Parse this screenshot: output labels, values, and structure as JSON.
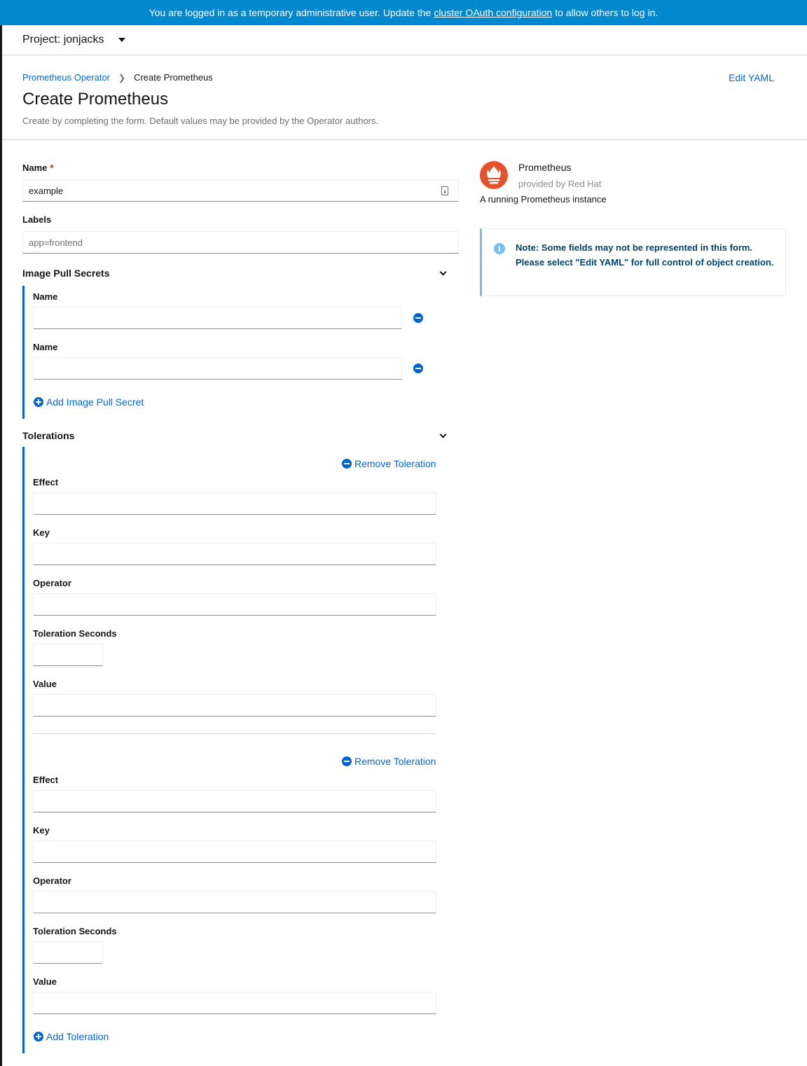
{
  "banner": {
    "text_before": "You are logged in as a temporary administrative user. Update the",
    "link": "cluster OAuth configuration",
    "text_after": "to allow others to log in."
  },
  "project": {
    "label": "Project: jonjacks"
  },
  "breadcrumb": {
    "parent": "Prometheus Operator",
    "current": "Create Prometheus"
  },
  "header": {
    "edit_yaml": "Edit YAML",
    "title": "Create Prometheus",
    "description": "Create by completing the form. Default values may be provided by the Operator authors."
  },
  "form": {
    "name_label": "Name",
    "required_mark": "*",
    "name_value": "example",
    "labels_label": "Labels",
    "labels_placeholder": "app=frontend",
    "image_pull_secrets": {
      "title": "Image Pull Secrets",
      "items": [
        {
          "label": "Name",
          "value": ""
        },
        {
          "label": "Name",
          "value": ""
        }
      ],
      "add_label": "Add Image Pull Secret"
    },
    "tolerations": {
      "title": "Tolerations",
      "remove_label": "Remove Toleration",
      "effect_label": "Effect",
      "key_label": "Key",
      "operator_label": "Operator",
      "seconds_label": "Toleration Seconds",
      "value_label": "Value",
      "add_label": "Add Toleration"
    }
  },
  "provider": {
    "name": "Prometheus",
    "provided_by": "provided by Red Hat",
    "description": "A running Prometheus instance"
  },
  "alert": {
    "text": "Note: Some fields may not be represented in this form. Please select \"Edit YAML\" for full control of object creation."
  },
  "colors": {
    "banner": "#0088ce",
    "link": "#0066cc",
    "logo": "#e6522c",
    "info": "#73bcf7"
  }
}
